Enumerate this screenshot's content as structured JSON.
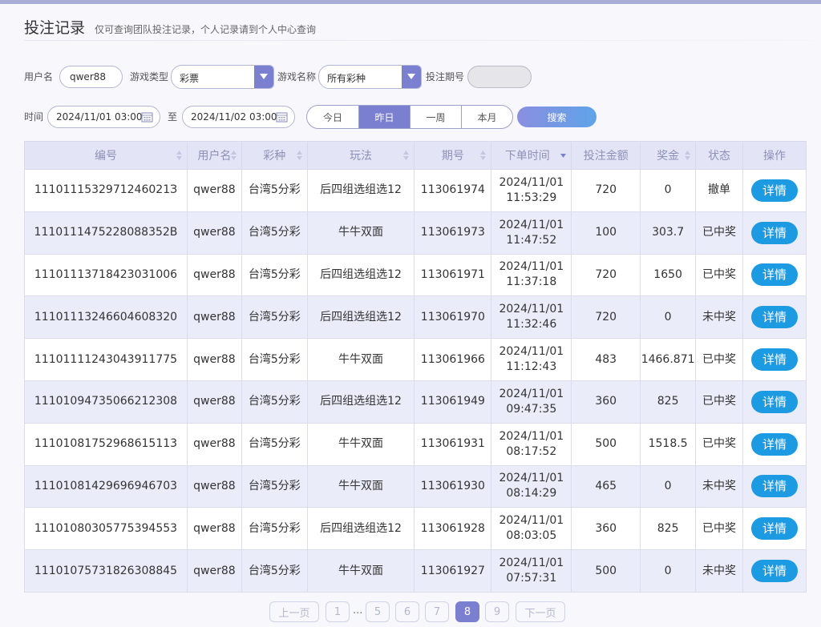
{
  "header": {
    "title": "投注记录",
    "subtitle": "仅可查询团队投注记录，个人记录请到个人中心查询"
  },
  "filters": {
    "username_label": "用户名",
    "username_value": "qwer88",
    "game_type_label": "游戏类型",
    "game_type_value": "彩票",
    "game_name_label": "游戏名称",
    "game_name_value": "所有彩种",
    "issue_label": "投注期号",
    "issue_value": "",
    "time_label": "时间",
    "time_from": "2024/11/01 03:00",
    "to_label": "至",
    "time_to": "2024/11/02 03:00",
    "ranges": [
      "今日",
      "昨日",
      "一周",
      "本月"
    ],
    "active_range": "昨日",
    "search_label": "搜索"
  },
  "table": {
    "columns": [
      "编号",
      "用户名",
      "彩种",
      "玩法",
      "期号",
      "下单时间",
      "投注金额",
      "奖金",
      "状态",
      "操作"
    ],
    "rows": [
      {
        "id": "1110111532971246021З",
        "user": "qwer88",
        "lottery": "台湾5分彩",
        "play": "后四组选组选12",
        "issue": "113061974",
        "date": "2024/11/01",
        "time": "11:53:29",
        "amount": "720",
        "prize": "0",
        "status": "撤单",
        "win": false,
        "action": "详情"
      },
      {
        "id": "1110111475228088352В",
        "user": "qwer88",
        "lottery": "台湾5分彩",
        "play": "牛牛双面",
        "issue": "113061973",
        "date": "2024/11/01",
        "time": "11:47:52",
        "amount": "100",
        "prize": "303.7",
        "status": "已中奖",
        "win": true,
        "action": "详情"
      },
      {
        "id": "11101113718423031006",
        "user": "qwer88",
        "lottery": "台湾5分彩",
        "play": "后四组选组选12",
        "issue": "113061971",
        "date": "2024/11/01",
        "time": "11:37:18",
        "amount": "720",
        "prize": "1650",
        "status": "已中奖",
        "win": true,
        "action": "详情"
      },
      {
        "id": "11101113246604608320",
        "user": "qwer88",
        "lottery": "台湾5分彩",
        "play": "后四组选组选12",
        "issue": "113061970",
        "date": "2024/11/01",
        "time": "11:32:46",
        "amount": "720",
        "prize": "0",
        "status": "未中奖",
        "win": false,
        "action": "详情"
      },
      {
        "id": "11101111243043911775",
        "user": "qwer88",
        "lottery": "台湾5分彩",
        "play": "牛牛双面",
        "issue": "113061966",
        "date": "2024/11/01",
        "time": "11:12:43",
        "amount": "483",
        "prize": "1466.871",
        "status": "已中奖",
        "win": true,
        "action": "详情"
      },
      {
        "id": "11101094735066212308",
        "user": "qwer88",
        "lottery": "台湾5分彩",
        "play": "后四组选组选12",
        "issue": "113061949",
        "date": "2024/11/01",
        "time": "09:47:35",
        "amount": "360",
        "prize": "825",
        "status": "已中奖",
        "win": true,
        "action": "详情"
      },
      {
        "id": "11101081752968615113",
        "user": "qwer88",
        "lottery": "台湾5分彩",
        "play": "牛牛双面",
        "issue": "113061931",
        "date": "2024/11/01",
        "time": "08:17:52",
        "amount": "500",
        "prize": "1518.5",
        "status": "已中奖",
        "win": true,
        "action": "详情"
      },
      {
        "id": "11101081429696946703",
        "user": "qwer88",
        "lottery": "台湾5分彩",
        "play": "牛牛双面",
        "issue": "113061930",
        "date": "2024/11/01",
        "time": "08:14:29",
        "amount": "465",
        "prize": "0",
        "status": "未中奖",
        "win": false,
        "action": "详情"
      },
      {
        "id": "11101080305775394553",
        "user": "qwer88",
        "lottery": "台湾5分彩",
        "play": "后四组选组选12",
        "issue": "113061928",
        "date": "2024/11/01",
        "time": "08:03:05",
        "amount": "360",
        "prize": "825",
        "status": "已中奖",
        "win": true,
        "action": "详情"
      },
      {
        "id": "11101075731826308845",
        "user": "qwer88",
        "lottery": "台湾5分彩",
        "play": "牛牛双面",
        "issue": "113061927",
        "date": "2024/11/01",
        "time": "07:57:31",
        "amount": "500",
        "prize": "0",
        "status": "未中奖",
        "win": false,
        "action": "详情"
      }
    ]
  },
  "pagination": {
    "prev_label": "上一页",
    "next_label": "下一页",
    "pages": [
      "1",
      "5",
      "6",
      "7",
      "8",
      "9"
    ],
    "ellipsis": "...",
    "current": "8"
  }
}
